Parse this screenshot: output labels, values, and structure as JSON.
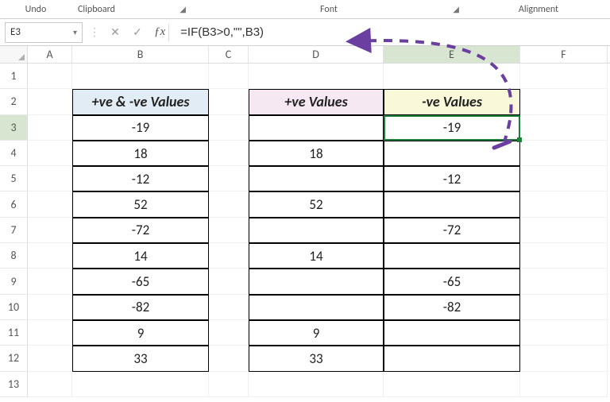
{
  "ribbon": {
    "undo": "Undo",
    "clipboard": "Clipboard",
    "font": "Font",
    "alignment": "Alignment"
  },
  "namebox": {
    "value": "E3"
  },
  "formula": {
    "value": "=IF(B3>0,\"\",B3)"
  },
  "columns": [
    "A",
    "B",
    "C",
    "D",
    "E",
    "F"
  ],
  "row_numbers": [
    1,
    2,
    3,
    4,
    5,
    6,
    7,
    8,
    9,
    10,
    11,
    12,
    13
  ],
  "headers": {
    "B": "+ve & -ve Values",
    "D": "+ve Values",
    "E": "-ve Values"
  },
  "data": {
    "B": [
      "-19",
      "18",
      "-12",
      "52",
      "-72",
      "14",
      "-65",
      "-82",
      "9",
      "33"
    ],
    "D": [
      "",
      "18",
      "",
      "52",
      "",
      "14",
      "",
      "",
      "9",
      "33"
    ],
    "E": [
      "-19",
      "",
      "-12",
      "",
      "-72",
      "",
      "-65",
      "-82",
      "",
      ""
    ]
  },
  "active_cell": "E3"
}
